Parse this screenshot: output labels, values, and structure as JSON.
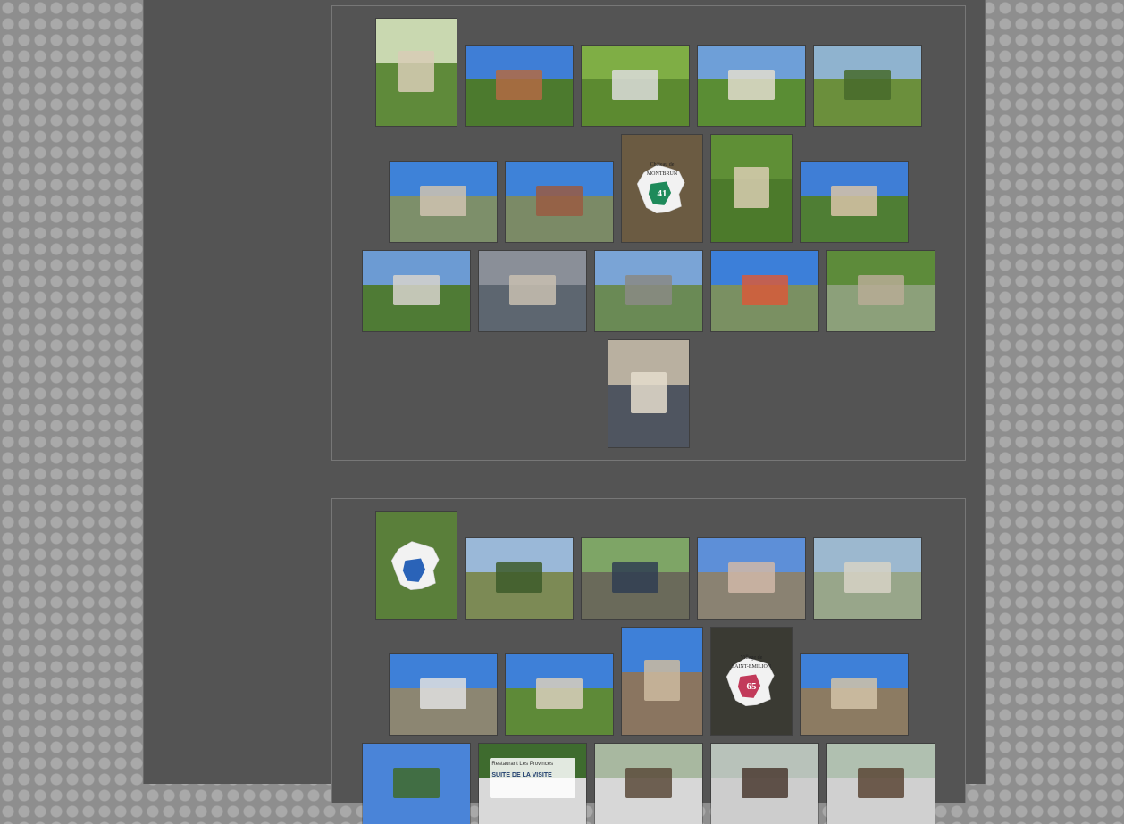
{
  "page": {
    "background_pattern": "dotted-grey",
    "column_color": "#545454"
  },
  "albums": [
    {
      "name": "album-1",
      "photos": [
        {
          "subject": "garden-miniature",
          "sky": "#c9d8b0",
          "ground": "#5f8a3a",
          "accent": "#d8cdb6"
        },
        {
          "subject": "brick-ruin-tourist",
          "sky": "#3f7ed6",
          "ground": "#4c7a2e",
          "accent": "#b36a43"
        },
        {
          "subject": "topiary-tree",
          "sky": "#7fae45",
          "ground": "#5c8a30",
          "accent": "#dcdcdc"
        },
        {
          "subject": "chateau-miniature",
          "sky": "#6e9fd8",
          "ground": "#5a8d34",
          "accent": "#e3ddcf"
        },
        {
          "subject": "hedge-garden",
          "sky": "#8fb3cf",
          "ground": "#6b8f3c",
          "accent": "#466a2a"
        },
        {
          "subject": "chateau-on-lake",
          "sky": "#3e82d8",
          "ground": "#7d8f6a",
          "accent": "#cfc3b0"
        },
        {
          "subject": "church-on-lake",
          "sky": "#3e82d8",
          "ground": "#7b8a66",
          "accent": "#9a5b42"
        },
        {
          "subject": "map-sign",
          "bg": "#6b5b42",
          "region_color": "#1e8a5a",
          "map_label_1": "Château de",
          "map_label_2": "MONTBRUN",
          "map_number": "41"
        },
        {
          "subject": "fortress-miniature",
          "sky": "#5f8f36",
          "ground": "#4c7a2b",
          "accent": "#d9ceb2"
        },
        {
          "subject": "group-photo",
          "sky": "#3f7ed6",
          "ground": "#4f7e34",
          "accent": "#d8c3a8"
        },
        {
          "subject": "chenonceau-miniature",
          "sky": "#6c9bd3",
          "ground": "#4f7b35",
          "accent": "#d7d4cc"
        },
        {
          "subject": "town-rooftops",
          "sky": "#8a8f98",
          "ground": "#5d6670",
          "accent": "#c8c0b0"
        },
        {
          "subject": "castle-rock",
          "sky": "#7aa4d6",
          "ground": "#6a8a55",
          "accent": "#8a8a85"
        },
        {
          "subject": "lake-park",
          "sky": "#3c7fd9",
          "ground": "#7a9062",
          "accent": "#d85a3a"
        },
        {
          "subject": "harbor-miniature",
          "sky": "#5d8b3a",
          "ground": "#8ca07a",
          "accent": "#b7ab95"
        },
        {
          "subject": "rooftops-closeup",
          "sky": "#b9b0a0",
          "ground": "#4f5560",
          "accent": "#e4ddcd"
        }
      ]
    },
    {
      "name": "album-2",
      "photos": [
        {
          "subject": "map-sign-blue",
          "bg": "#5a7f3a",
          "region_color": "#2a63b8",
          "map_label_1": "",
          "map_label_2": "",
          "map_number": ""
        },
        {
          "subject": "pond-trees",
          "sky": "#9ab8d8",
          "ground": "#7c8a55",
          "accent": "#3d5a2a"
        },
        {
          "subject": "visitors-walking",
          "sky": "#7ea566",
          "ground": "#6a6a5a",
          "accent": "#2f3d52"
        },
        {
          "subject": "friends-sitting",
          "sky": "#5d8fd8",
          "ground": "#8a8272",
          "accent": "#d0b8a8"
        },
        {
          "subject": "port-miniature",
          "sky": "#9cb8cf",
          "ground": "#98a68a",
          "accent": "#d7d2c6"
        },
        {
          "subject": "girl-path",
          "sky": "#3e80d8",
          "ground": "#8c8672",
          "accent": "#e1e1e1"
        },
        {
          "subject": "fortification",
          "sky": "#3e80d8",
          "ground": "#5e8a38",
          "accent": "#d9cfbd"
        },
        {
          "subject": "village-church",
          "sky": "#3e80d8",
          "ground": "#8a7560",
          "accent": "#cdbba0"
        },
        {
          "subject": "map-sign-red",
          "bg": "#3a3a33",
          "region_color": "#c23a5a",
          "map_label_1": "Village de",
          "map_label_2": "SAINT-EMILION",
          "map_number": "65"
        },
        {
          "subject": "village-panorama",
          "sky": "#3e80d8",
          "ground": "#8c7b62",
          "accent": "#d2c3a8"
        },
        {
          "subject": "blue-sky",
          "sky": "#4a84d8",
          "ground": "#4a84d8",
          "accent": "#3f6a2a"
        },
        {
          "subject": "restaurant-sign",
          "sky": "#3e6b2e",
          "ground": "#d9d9d9",
          "accent": "#2a5a9a",
          "sign_line_1": "Restaurant Les Provinces",
          "sign_line_2": "SUITE DE LA VISITE"
        },
        {
          "subject": "group-table-1",
          "sky": "#a8b8a0",
          "ground": "#d7d7d7",
          "accent": "#5a4a3a"
        },
        {
          "subject": "group-table-2",
          "sky": "#b8c2ba",
          "ground": "#cdcdcd",
          "accent": "#4a3a30"
        },
        {
          "subject": "group-table-3",
          "sky": "#b0c0b0",
          "ground": "#d0d0d0",
          "accent": "#5a4535"
        }
      ]
    }
  ]
}
